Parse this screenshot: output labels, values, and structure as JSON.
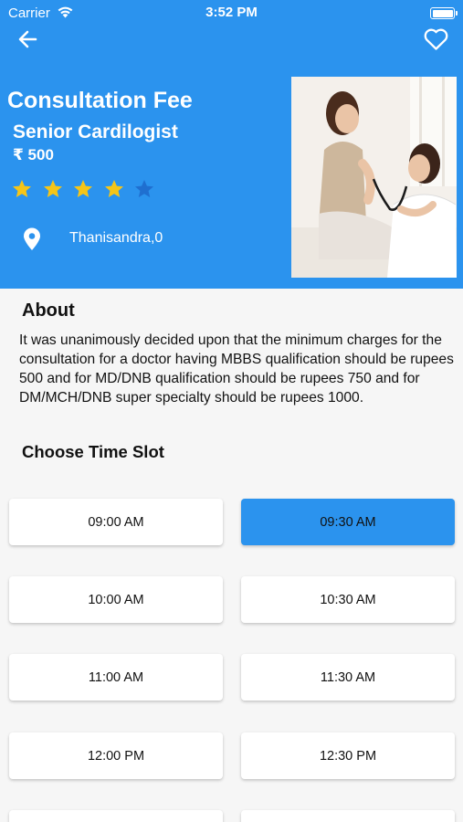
{
  "status_bar": {
    "carrier": "Carrier",
    "time": "3:52 PM"
  },
  "colors": {
    "primary": "#2b93ee",
    "star_filled": "#f5c518",
    "star_empty": "#1f6fd0",
    "background": "#f6f6f6"
  },
  "header": {
    "back_icon": "arrow-left-icon",
    "favorite_icon": "heart-outline-icon",
    "title": "Consultation Fee",
    "specialty": "Senior Cardilogist",
    "fee": "₹ 500",
    "rating": 4,
    "rating_max": 5,
    "location_icon": "map-pin-icon",
    "location": "Thanisandra,0"
  },
  "about": {
    "heading": "About",
    "text": "It was unanimously decided upon that the minimum charges for the consultation for a doctor having MBBS qualification should be rupees 500 and for MD/DNB qualification should be rupees 750 and for DM/MCH/DNB super specialty should be rupees 1000."
  },
  "time_slots": {
    "heading": "Choose Time Slot",
    "selected": "09:30 AM",
    "slots": [
      "09:00 AM",
      "09:30 AM",
      "10:00 AM",
      "10:30 AM",
      "11:00 AM",
      "11:30 AM",
      "12:00 PM",
      "12:30 PM"
    ]
  }
}
